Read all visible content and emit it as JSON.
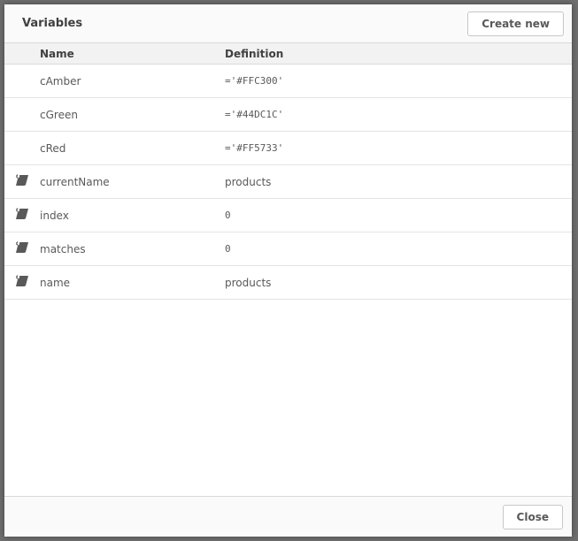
{
  "dialog": {
    "title": "Variables",
    "create_button": "Create new",
    "close_button": "Close"
  },
  "table": {
    "columns": [
      "Name",
      "Definition"
    ],
    "rows": [
      {
        "name": "cAmber",
        "definition": "='#FFC300'",
        "script_icon": false,
        "mono": true
      },
      {
        "name": "cGreen",
        "definition": "='#44DC1C'",
        "script_icon": false,
        "mono": true
      },
      {
        "name": "cRed",
        "definition": "='#FF5733'",
        "script_icon": false,
        "mono": true
      },
      {
        "name": "currentName",
        "definition": "products",
        "script_icon": true,
        "mono": false
      },
      {
        "name": "index",
        "definition": "0",
        "script_icon": true,
        "mono": true
      },
      {
        "name": "matches",
        "definition": "0",
        "script_icon": true,
        "mono": true
      },
      {
        "name": "name",
        "definition": "products",
        "script_icon": true,
        "mono": false
      }
    ]
  }
}
